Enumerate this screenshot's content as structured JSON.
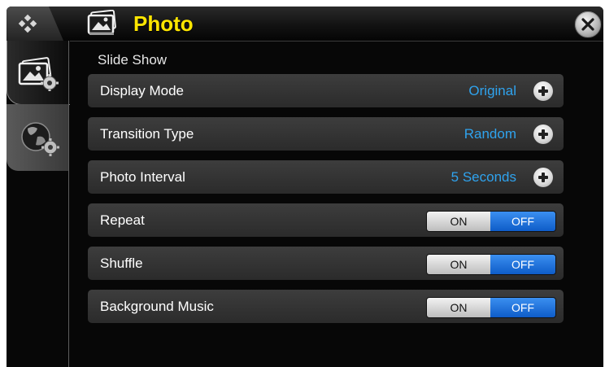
{
  "header": {
    "title": "Photo",
    "title_color": "#ffe600",
    "home_icon": "home-diamond-icon",
    "title_icon": "photo-icon",
    "close_icon": "close-icon"
  },
  "sidebar": {
    "tabs": [
      {
        "name": "photo-settings",
        "icon": "photo-settings-icon",
        "active": true
      },
      {
        "name": "globe-settings",
        "icon": "globe-settings-icon",
        "active": false
      }
    ]
  },
  "section": {
    "title": "Slide Show"
  },
  "settings": [
    {
      "label": "Display Mode",
      "type": "select",
      "value": "Original"
    },
    {
      "label": "Transition Type",
      "type": "select",
      "value": "Random"
    },
    {
      "label": "Photo Interval",
      "type": "select",
      "value": "5 Seconds"
    },
    {
      "label": "Repeat",
      "type": "toggle",
      "on_label": "ON",
      "off_label": "OFF",
      "selected": "OFF"
    },
    {
      "label": "Shuffle",
      "type": "toggle",
      "on_label": "ON",
      "off_label": "OFF",
      "selected": "OFF"
    },
    {
      "label": "Background Music",
      "type": "toggle",
      "on_label": "ON",
      "off_label": "OFF",
      "selected": "OFF"
    }
  ],
  "colors": {
    "value_text": "#2fa3ee",
    "toggle_selected": "#1a6fdc",
    "background": "#070707"
  }
}
